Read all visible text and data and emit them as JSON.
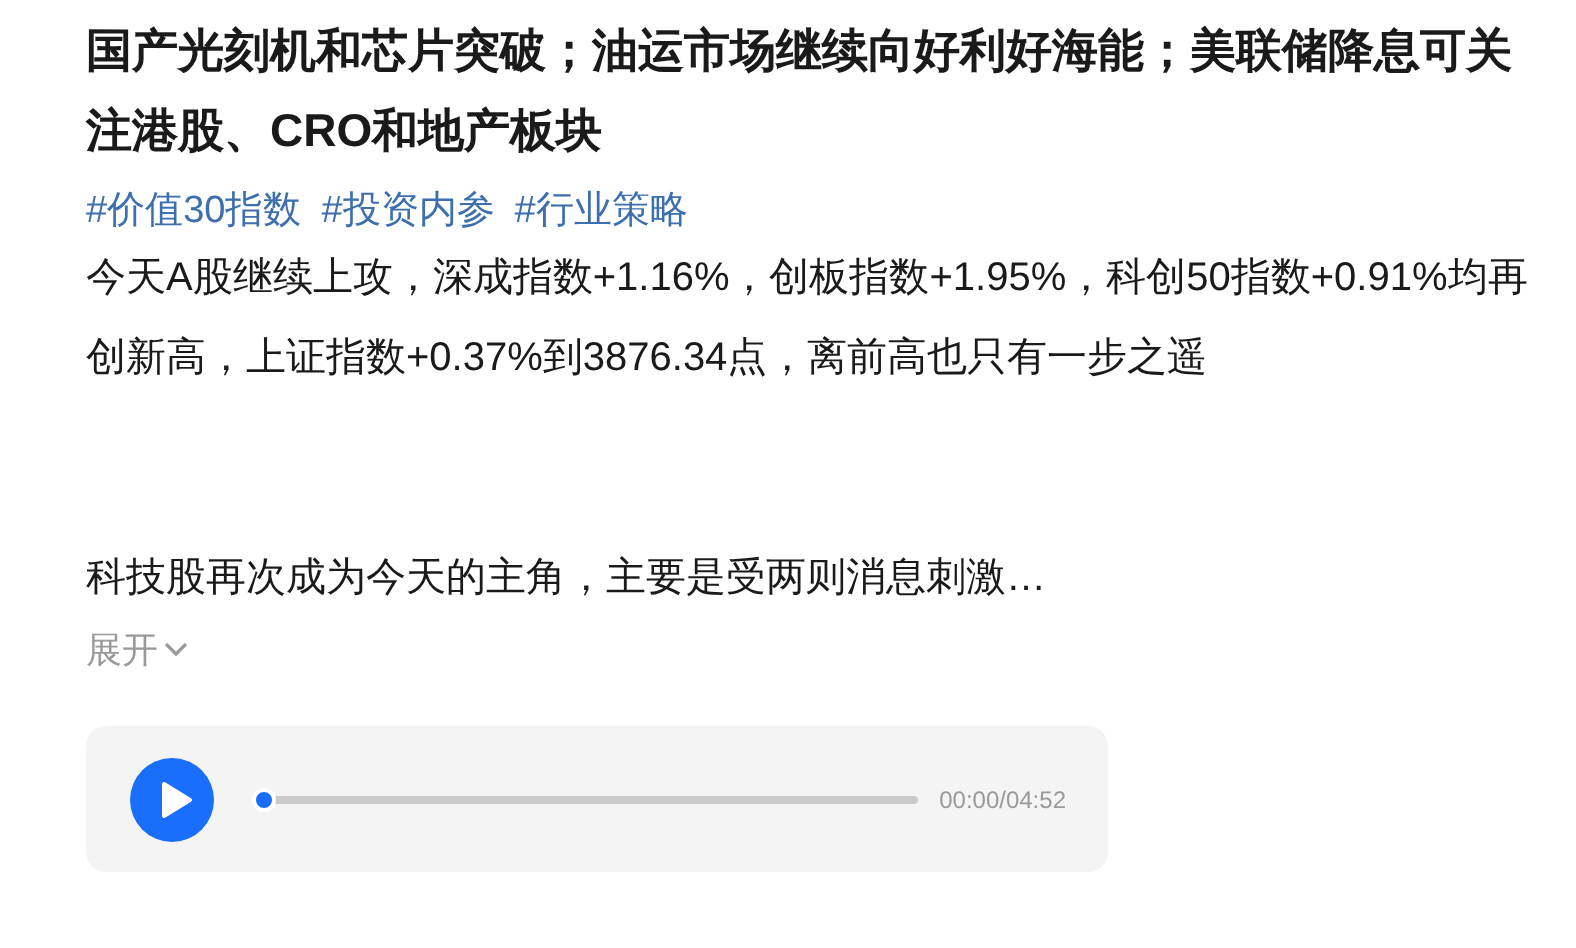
{
  "title": "国产光刻机和芯片突破；油运市场继续向好利好海能；美联储降息可关注港股、CRO和地产板块",
  "tags": [
    "#价值30指数",
    "#投资内参",
    "#行业策略"
  ],
  "paragraphs": [
    "今天A股继续上攻，深成指数+1.16%，创板指数+1.95%，科创50指数+0.91%均再创新高，上证指数+0.37%到3876.34点，离前高也只有一步之遥",
    "科技股再次成为今天的主角，主要是受两则消息刺激…"
  ],
  "expand": {
    "label": "展开",
    "expanded": false
  },
  "player": {
    "playing": false,
    "level": 0,
    "time": "00:00/04:52"
  }
}
